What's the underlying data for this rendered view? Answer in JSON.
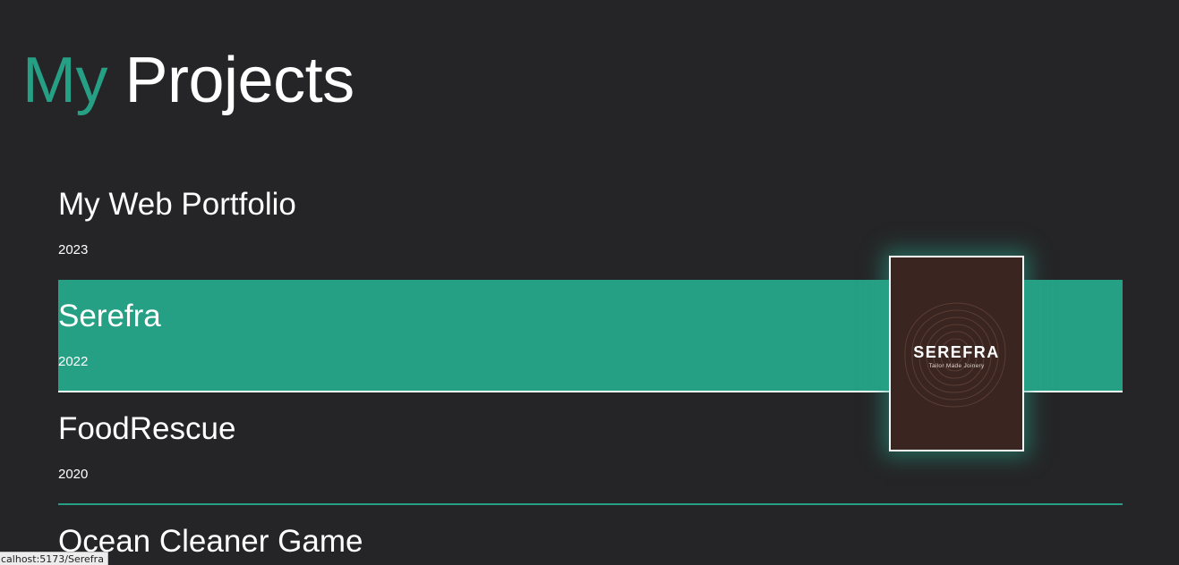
{
  "header": {
    "title_accent": "My",
    "title_rest": "Projects"
  },
  "projects": [
    {
      "name": "My Web Portfolio",
      "year": "2023"
    },
    {
      "name": "Serefra",
      "year": "2022"
    },
    {
      "name": "FoodRescue",
      "year": "2020"
    },
    {
      "name": "Ocean Cleaner Game",
      "year": ""
    }
  ],
  "preview": {
    "logo_text": "SEREFRA",
    "tagline": "Tailor Made Joinery",
    "icon": "tree-rings-icon"
  },
  "status_bar": {
    "url": "calhost:5173/Serefra"
  },
  "colors": {
    "background": "#252527",
    "accent": "#26a085",
    "preview_bg": "#3a2520",
    "text": "#ffffff"
  }
}
